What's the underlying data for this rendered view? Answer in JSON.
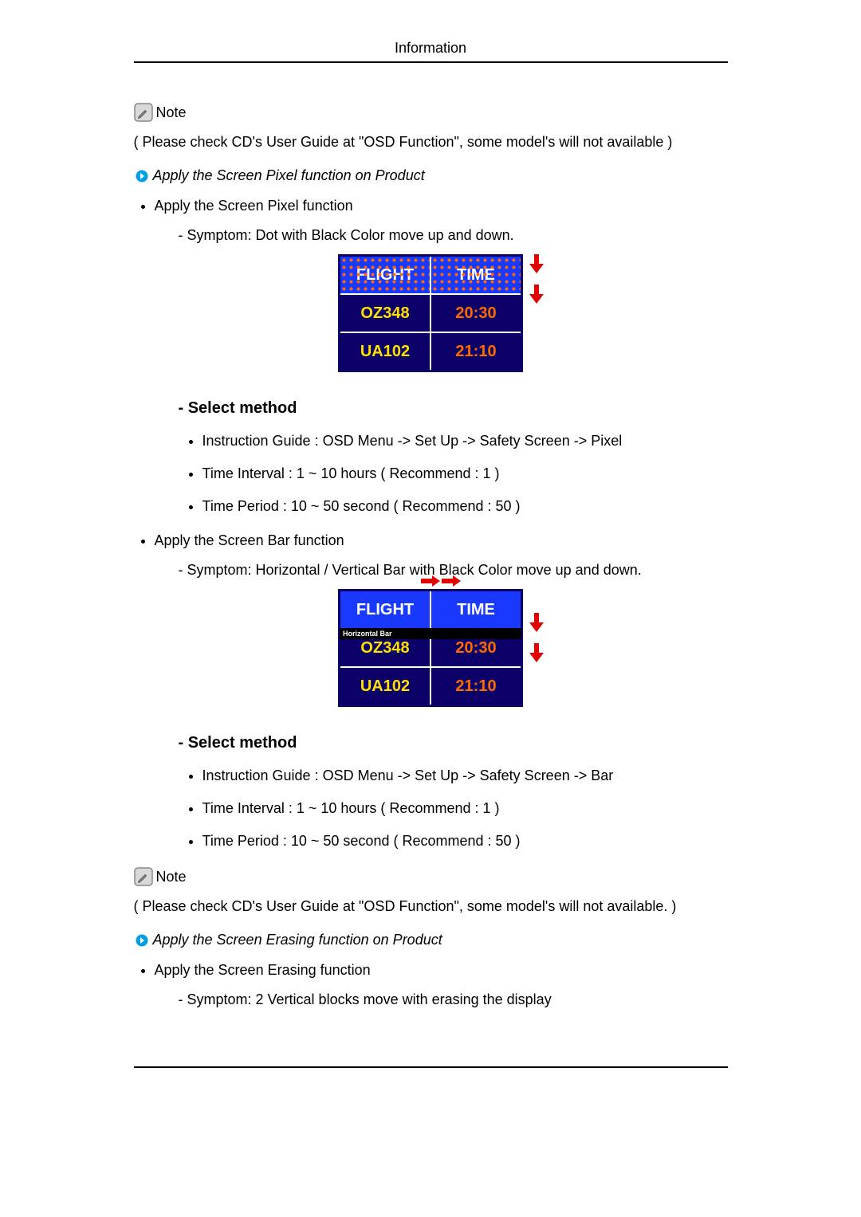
{
  "header": {
    "title": "Information"
  },
  "note1": {
    "label": "Note",
    "text": "( Please check CD's User Guide at \"OSD Function\", some model's will not available )"
  },
  "sectionA": {
    "arrow_text": "Apply the Screen Pixel function on Product",
    "bullet": "Apply the Screen Pixel function",
    "symptom": "- Symptom: Dot with Black Color move up and down.",
    "table": {
      "headers": [
        "FLIGHT",
        "TIME"
      ],
      "rows": [
        {
          "flight": "OZ348",
          "time": "20:30"
        },
        {
          "flight": "UA102",
          "time": "21:10"
        }
      ]
    },
    "select": {
      "title": "- Select method",
      "items": [
        "Instruction Guide : OSD Menu -> Set Up -> Safety Screen -> Pixel",
        "Time Interval : 1 ~ 10 hours ( Recommend : 1 )",
        "Time Period : 10 ~ 50 second ( Recommend : 50 )"
      ]
    }
  },
  "sectionB": {
    "bullet": "Apply the Screen Bar function",
    "symptom": "- Symptom: Horizontal / Vertical Bar with Black Color move up and down.",
    "h_bar_label": "Horizontal Bar",
    "table": {
      "headers": [
        "FLIGHT",
        "TIME"
      ],
      "rows": [
        {
          "flight": "OZ348",
          "time": "20:30"
        },
        {
          "flight": "UA102",
          "time": "21:10"
        }
      ]
    },
    "select": {
      "title": "- Select method",
      "items": [
        "Instruction Guide : OSD Menu -> Set Up -> Safety Screen -> Bar",
        "Time Interval : 1 ~ 10 hours ( Recommend : 1 )",
        "Time Period : 10 ~ 50 second ( Recommend : 50 )"
      ]
    }
  },
  "note2": {
    "label": "Note",
    "text": "( Please check CD's User Guide at \"OSD Function\", some model's will not available. )"
  },
  "sectionC": {
    "arrow_text": "Apply the Screen Erasing function on Product",
    "bullet": "Apply the Screen Erasing function",
    "symptom": "- Symptom: 2 Vertical blocks move with erasing the display"
  }
}
